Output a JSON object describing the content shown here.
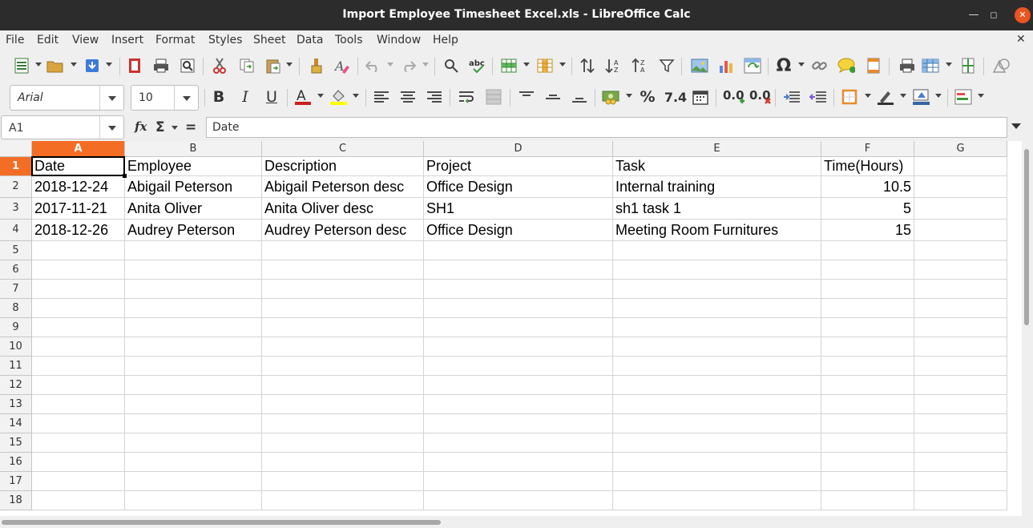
{
  "window": {
    "title": "Import Employee Timesheet Excel.xls - LibreOffice Calc"
  },
  "menu": [
    "File",
    "Edit",
    "View",
    "Insert",
    "Format",
    "Styles",
    "Sheet",
    "Data",
    "Tools",
    "Window",
    "Help"
  ],
  "format_toolbar": {
    "font_name": "Arial",
    "font_size": "10"
  },
  "formula_bar": {
    "cell_ref": "A1",
    "content": "Date"
  },
  "sheet": {
    "columns": [
      "A",
      "B",
      "C",
      "D",
      "E",
      "F",
      "G"
    ],
    "selected_column": "A",
    "selected_row": "1",
    "row_numbers": [
      "1",
      "2",
      "3",
      "4",
      "5",
      "6",
      "7",
      "8",
      "9",
      "10",
      "11",
      "12",
      "13",
      "14",
      "15",
      "16",
      "17",
      "18"
    ],
    "header": [
      "Date",
      "Employee",
      "Description",
      "Project",
      "Task",
      "Time(Hours)"
    ],
    "rows": [
      [
        "2018-12-24",
        "Abigail Peterson",
        "Abigail Peterson desc",
        "Office Design",
        "Internal training",
        "10.5"
      ],
      [
        "2017-11-21",
        "Anita Oliver",
        "Anita Oliver desc",
        "SH1",
        "sh1 task 1",
        "5"
      ],
      [
        "2018-12-26",
        "Audrey Peterson",
        "Audrey Peterson desc",
        "Office Design",
        "Meeting Room Furnitures",
        "15"
      ]
    ]
  },
  "colors": {
    "selection_header": "#f46d25",
    "titlebar": "#2c2c2c",
    "close_button": "#e95420"
  }
}
